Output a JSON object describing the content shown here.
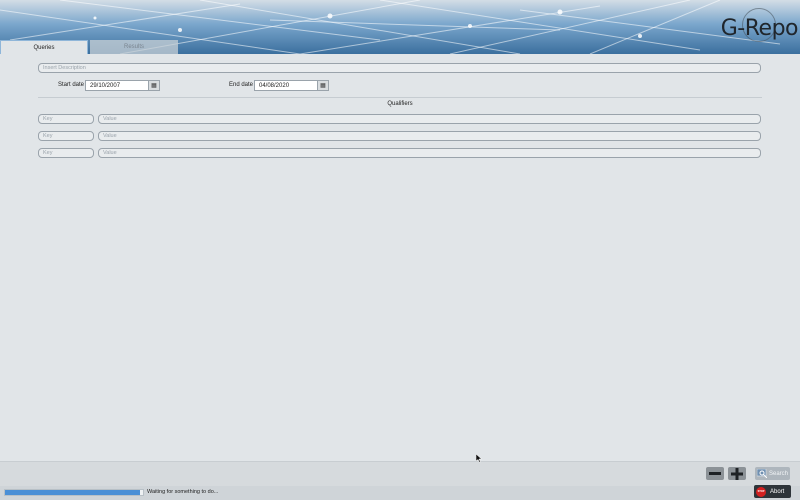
{
  "app": {
    "logo_text": "G-Repo"
  },
  "tabs": [
    {
      "label": "Queries",
      "active": true
    },
    {
      "label": "Results",
      "active": false
    }
  ],
  "query": {
    "search_placeholder": "Insert Description",
    "start_date_label": "Start date",
    "start_date_value": "29/10/2007",
    "end_date_label": "End date",
    "end_date_value": "04/08/2020"
  },
  "qualifiers": {
    "title": "Qualifiers",
    "rows": [
      {
        "key_placeholder": "Key",
        "value_placeholder": "Value"
      },
      {
        "key_placeholder": "Key",
        "value_placeholder": "Value"
      },
      {
        "key_placeholder": "Key",
        "value_placeholder": "Value"
      }
    ]
  },
  "actions": {
    "search_label": "Search",
    "abort_label": "Abort",
    "stop_icon_text": "STOP"
  },
  "status": {
    "text": "Waiting for something to do...",
    "progress": 0.98
  },
  "icons": [
    "calendar-icon",
    "minus-icon",
    "plus-icon",
    "search-icon",
    "stop-icon",
    "mouse-cursor-icon"
  ],
  "colors": {
    "accent": "#4a8fd6",
    "abort_bg": "#2e3439",
    "stop_red": "#d32020"
  }
}
